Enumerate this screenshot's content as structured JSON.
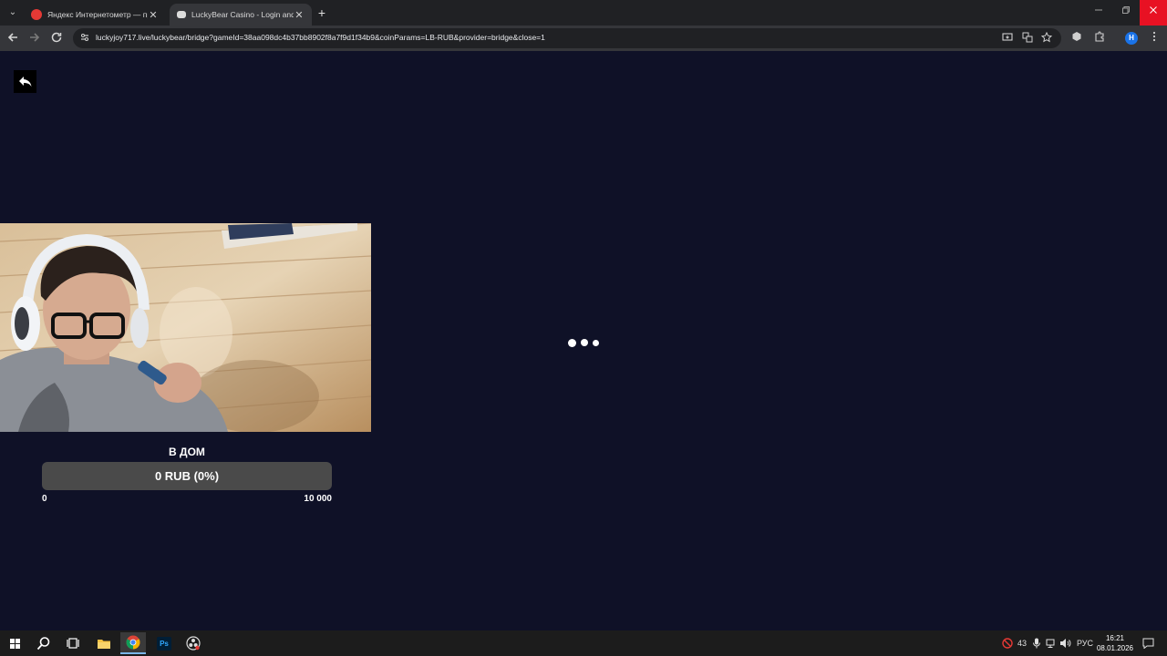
{
  "browser": {
    "tabs": [
      {
        "title": "Яндекс Интернетометр — про",
        "active": false
      },
      {
        "title": "LuckyBear Casino - Login and A",
        "active": true
      }
    ],
    "url": "luckyjoy717.live/luckybear/bridge?gameId=38aa098dc4b37bb8902f8a7f9d1f34b9&coinParams=LB-RUB&provider=bridge&close=1",
    "profile_initial": "H",
    "close_symbol": "✕",
    "new_tab_symbol": "+"
  },
  "page": {
    "background": "#0f1127",
    "goal": {
      "title": "В ДОМ",
      "progress_text": "0 RUB (0%)",
      "progress_fraction": 0,
      "min_label": "0",
      "max_label": "10 000"
    },
    "loader_dots": 3
  },
  "taskbar": {
    "apps": [
      "start",
      "search",
      "task-view",
      "file-explorer",
      "chrome",
      "photoshop",
      "obs"
    ],
    "photoshop_label": "Ps",
    "tray": {
      "weather_temp": "43",
      "language": "РУС",
      "time": "16:21",
      "date": "08.01.2026"
    }
  }
}
